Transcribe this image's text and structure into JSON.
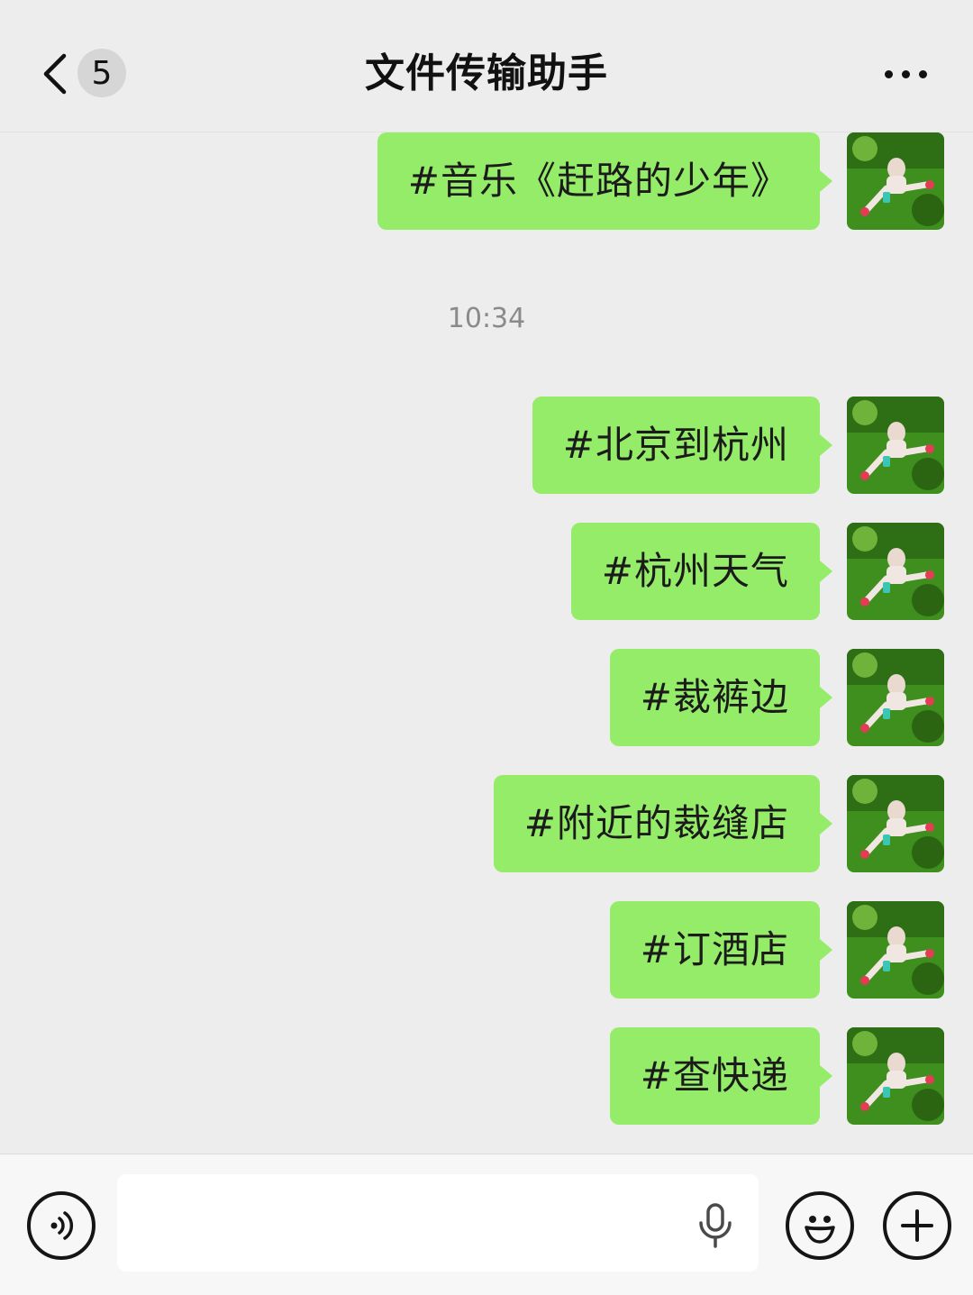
{
  "header": {
    "back_badge": "5",
    "title": "文件传输助手"
  },
  "timestamp": "10:34",
  "messages": [
    "#音乐《赶路的少年》",
    "#北京到杭州",
    "#杭州天气",
    "#裁裤边",
    "#附近的裁缝店",
    "#订酒店",
    "#查快递"
  ],
  "input": {
    "value": ""
  },
  "icons": {
    "back": "chevron-left-icon",
    "more": "more-dots-icon",
    "voice": "voice-icon",
    "mic": "microphone-icon",
    "emoji": "emoji-icon",
    "plus": "plus-icon"
  },
  "colors": {
    "bubble": "#95ec69",
    "background": "#ededed"
  }
}
